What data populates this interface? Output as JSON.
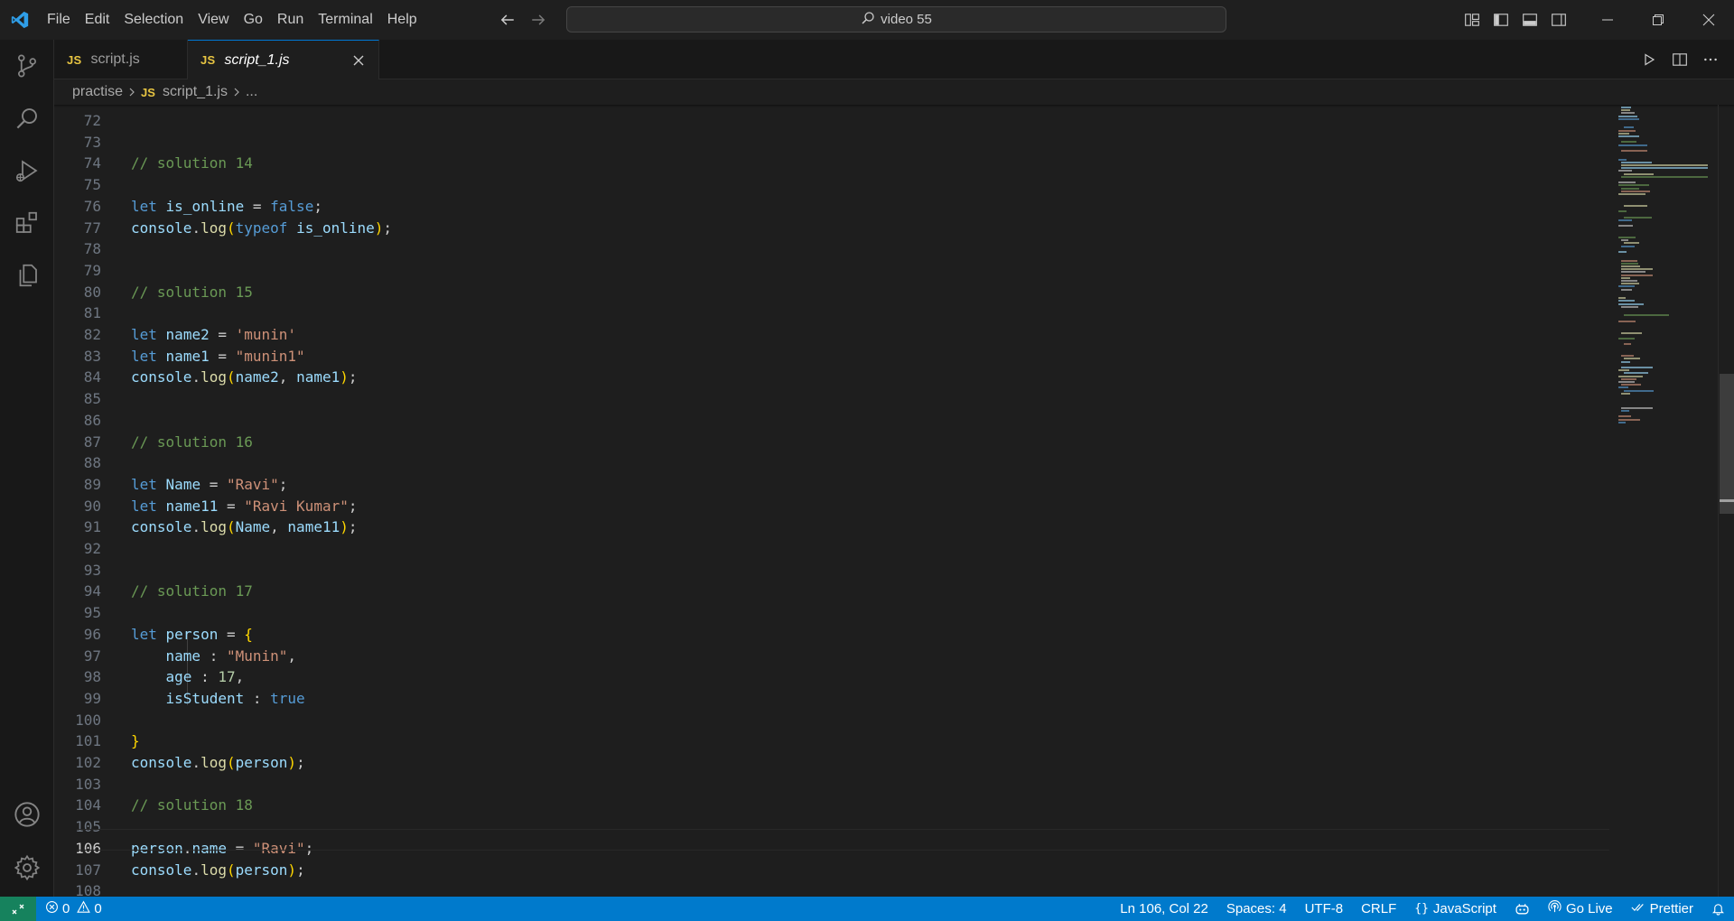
{
  "menu": [
    "File",
    "Edit",
    "Selection",
    "View",
    "Go",
    "Run",
    "Terminal",
    "Help"
  ],
  "command_center": {
    "label": "video 55",
    "icon": "search-icon"
  },
  "tabs": [
    {
      "badge": "JS",
      "label": "script.js",
      "active": false
    },
    {
      "badge": "JS",
      "label": "script_1.js",
      "active": true,
      "italic": true
    }
  ],
  "breadcrumb": {
    "folder": "practise",
    "badge": "JS",
    "file": "script_1.js",
    "more": "..."
  },
  "editor": {
    "current_line": 106,
    "lines": [
      {
        "n": "72",
        "tokens": []
      },
      {
        "n": "73",
        "tokens": []
      },
      {
        "n": "74",
        "tokens": [
          {
            "c": "com",
            "t": "// solution 14"
          }
        ]
      },
      {
        "n": "75",
        "tokens": []
      },
      {
        "n": "76",
        "tokens": [
          {
            "c": "kw",
            "t": "let"
          },
          {
            "c": "",
            "t": " "
          },
          {
            "c": "var",
            "t": "is_online"
          },
          {
            "c": "",
            "t": " = "
          },
          {
            "c": "kw",
            "t": "false"
          },
          {
            "c": "",
            "t": ";"
          }
        ]
      },
      {
        "n": "77",
        "tokens": [
          {
            "c": "var",
            "t": "console"
          },
          {
            "c": "",
            "t": "."
          },
          {
            "c": "fn",
            "t": "log"
          },
          {
            "c": "p1",
            "t": "("
          },
          {
            "c": "kw",
            "t": "typeof"
          },
          {
            "c": "",
            "t": " "
          },
          {
            "c": "var",
            "t": "is_online"
          },
          {
            "c": "p1",
            "t": ")"
          },
          {
            "c": "",
            "t": ";"
          }
        ]
      },
      {
        "n": "78",
        "tokens": []
      },
      {
        "n": "79",
        "tokens": []
      },
      {
        "n": "80",
        "tokens": [
          {
            "c": "com",
            "t": "// solution 15"
          }
        ]
      },
      {
        "n": "81",
        "tokens": []
      },
      {
        "n": "82",
        "tokens": [
          {
            "c": "kw",
            "t": "let"
          },
          {
            "c": "",
            "t": " "
          },
          {
            "c": "var",
            "t": "name2"
          },
          {
            "c": "",
            "t": " = "
          },
          {
            "c": "str",
            "t": "'munin'"
          }
        ]
      },
      {
        "n": "83",
        "tokens": [
          {
            "c": "kw",
            "t": "let"
          },
          {
            "c": "",
            "t": " "
          },
          {
            "c": "var",
            "t": "name1"
          },
          {
            "c": "",
            "t": " = "
          },
          {
            "c": "str",
            "t": "\"munin1\""
          }
        ]
      },
      {
        "n": "84",
        "tokens": [
          {
            "c": "var",
            "t": "console"
          },
          {
            "c": "",
            "t": "."
          },
          {
            "c": "fn",
            "t": "log"
          },
          {
            "c": "p1",
            "t": "("
          },
          {
            "c": "var",
            "t": "name2"
          },
          {
            "c": "",
            "t": ", "
          },
          {
            "c": "var",
            "t": "name1"
          },
          {
            "c": "p1",
            "t": ")"
          },
          {
            "c": "",
            "t": ";"
          }
        ]
      },
      {
        "n": "85",
        "tokens": []
      },
      {
        "n": "86",
        "tokens": []
      },
      {
        "n": "87",
        "tokens": [
          {
            "c": "com",
            "t": "// solution 16"
          }
        ]
      },
      {
        "n": "88",
        "tokens": []
      },
      {
        "n": "89",
        "tokens": [
          {
            "c": "kw",
            "t": "let"
          },
          {
            "c": "",
            "t": " "
          },
          {
            "c": "var",
            "t": "Name"
          },
          {
            "c": "",
            "t": " = "
          },
          {
            "c": "str",
            "t": "\"Ravi\""
          },
          {
            "c": "",
            "t": ";"
          }
        ]
      },
      {
        "n": "90",
        "tokens": [
          {
            "c": "kw",
            "t": "let"
          },
          {
            "c": "",
            "t": " "
          },
          {
            "c": "var",
            "t": "name11"
          },
          {
            "c": "",
            "t": " = "
          },
          {
            "c": "str",
            "t": "\"Ravi Kumar\""
          },
          {
            "c": "",
            "t": ";"
          }
        ]
      },
      {
        "n": "91",
        "tokens": [
          {
            "c": "var",
            "t": "console"
          },
          {
            "c": "",
            "t": "."
          },
          {
            "c": "fn",
            "t": "log"
          },
          {
            "c": "p1",
            "t": "("
          },
          {
            "c": "var",
            "t": "Name"
          },
          {
            "c": "",
            "t": ", "
          },
          {
            "c": "var",
            "t": "name11"
          },
          {
            "c": "p1",
            "t": ")"
          },
          {
            "c": "",
            "t": ";"
          }
        ]
      },
      {
        "n": "92",
        "tokens": []
      },
      {
        "n": "93",
        "tokens": []
      },
      {
        "n": "94",
        "tokens": [
          {
            "c": "com",
            "t": "// solution 17"
          }
        ]
      },
      {
        "n": "95",
        "tokens": []
      },
      {
        "n": "96",
        "tokens": [
          {
            "c": "kw",
            "t": "let"
          },
          {
            "c": "",
            "t": " "
          },
          {
            "c": "var",
            "t": "person"
          },
          {
            "c": "",
            "t": " = "
          },
          {
            "c": "p1",
            "t": "{"
          }
        ]
      },
      {
        "n": "97",
        "tokens": [
          {
            "c": "",
            "t": "    "
          },
          {
            "c": "prop",
            "t": "name"
          },
          {
            "c": "",
            "t": " : "
          },
          {
            "c": "str",
            "t": "\"Munin\""
          },
          {
            "c": "",
            "t": ","
          }
        ]
      },
      {
        "n": "98",
        "tokens": [
          {
            "c": "",
            "t": "    "
          },
          {
            "c": "prop",
            "t": "age"
          },
          {
            "c": "",
            "t": " : "
          },
          {
            "c": "num",
            "t": "17"
          },
          {
            "c": "",
            "t": ","
          }
        ]
      },
      {
        "n": "99",
        "tokens": [
          {
            "c": "",
            "t": "    "
          },
          {
            "c": "prop",
            "t": "isStudent"
          },
          {
            "c": "",
            "t": " : "
          },
          {
            "c": "kw",
            "t": "true"
          }
        ]
      },
      {
        "n": "100",
        "tokens": []
      },
      {
        "n": "101",
        "tokens": [
          {
            "c": "p1",
            "t": "}"
          }
        ]
      },
      {
        "n": "102",
        "tokens": [
          {
            "c": "var",
            "t": "console"
          },
          {
            "c": "",
            "t": "."
          },
          {
            "c": "fn",
            "t": "log"
          },
          {
            "c": "p1",
            "t": "("
          },
          {
            "c": "var",
            "t": "person"
          },
          {
            "c": "p1",
            "t": ")"
          },
          {
            "c": "",
            "t": ";"
          }
        ]
      },
      {
        "n": "103",
        "tokens": []
      },
      {
        "n": "104",
        "tokens": [
          {
            "c": "com",
            "t": "// solution 18"
          }
        ]
      },
      {
        "n": "105",
        "tokens": []
      },
      {
        "n": "106",
        "tokens": [
          {
            "c": "var",
            "t": "person"
          },
          {
            "c": "",
            "t": "."
          },
          {
            "c": "prop",
            "t": "name"
          },
          {
            "c": "",
            "t": " = "
          },
          {
            "c": "str",
            "t": "\"Ravi\""
          },
          {
            "c": "",
            "t": ";"
          }
        ]
      },
      {
        "n": "107",
        "tokens": [
          {
            "c": "var",
            "t": "console"
          },
          {
            "c": "",
            "t": "."
          },
          {
            "c": "fn",
            "t": "log"
          },
          {
            "c": "p1",
            "t": "("
          },
          {
            "c": "var",
            "t": "person"
          },
          {
            "c": "p1",
            "t": ")"
          },
          {
            "c": "",
            "t": ";"
          }
        ]
      },
      {
        "n": "108",
        "tokens": []
      }
    ]
  },
  "status": {
    "errors": "0",
    "warnings": "0",
    "position": "Ln 106, Col 22",
    "spaces": "Spaces: 4",
    "encoding": "UTF-8",
    "eol": "CRLF",
    "language": "JavaScript",
    "go_live": "Go Live",
    "prettier": "Prettier"
  },
  "colors": {
    "accent": "#007acc",
    "statusbar": "#007acc",
    "remote": "#16825d",
    "js_badge": "#e8c542",
    "comment": "#6a9955",
    "keyword": "#569cd6",
    "string": "#ce9178"
  }
}
